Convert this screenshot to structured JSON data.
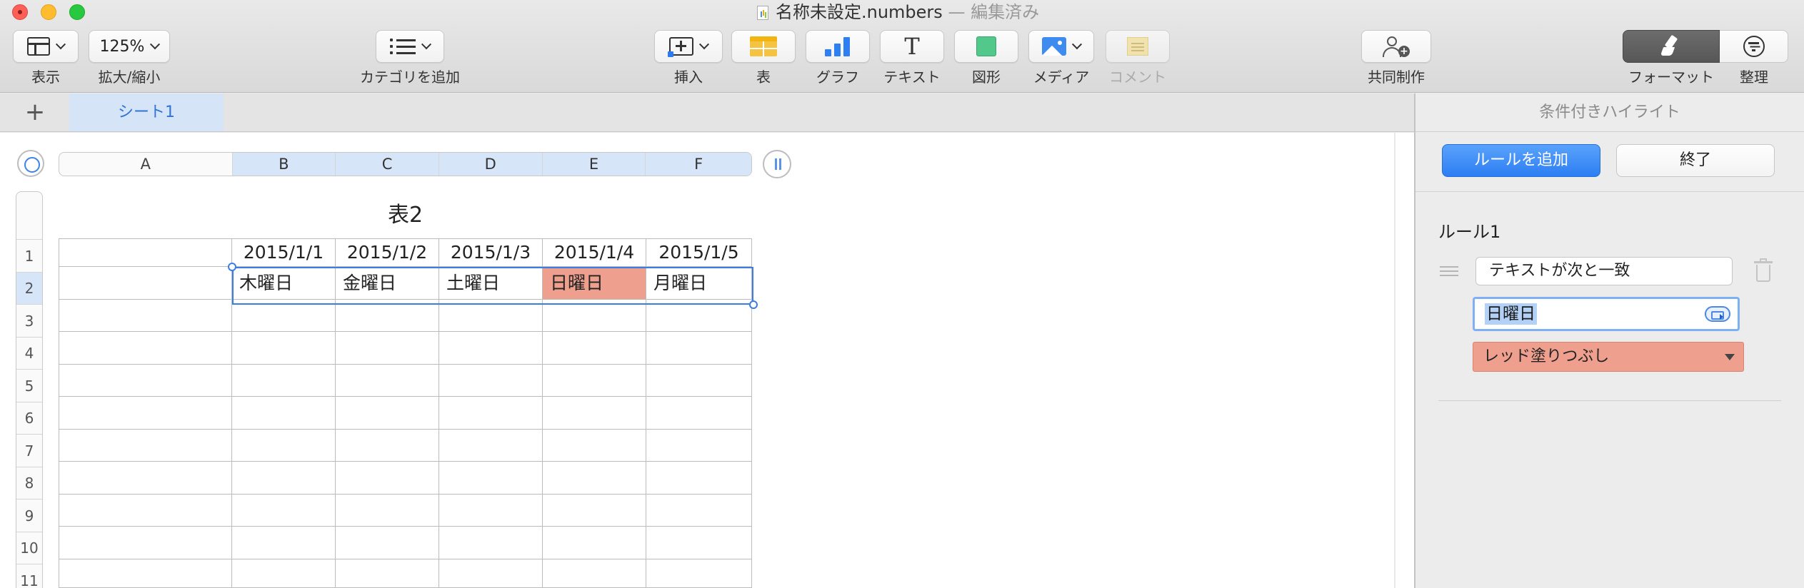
{
  "window": {
    "title": "名称未設定.numbers",
    "edited_suffix": "— 編集済み"
  },
  "toolbar": {
    "view_label": "表示",
    "zoom_value": "125%",
    "zoom_label": "拡大/縮小",
    "category_label": "カテゴリを追加",
    "insert_label": "挿入",
    "table_label": "表",
    "chart_label": "グラフ",
    "text_label": "テキスト",
    "shape_label": "図形",
    "media_label": "メディア",
    "comment_label": "コメント",
    "collaborate_label": "共同制作",
    "format_label": "フォーマット",
    "organize_label": "整理",
    "colors": {
      "chart_blue": "#2e7ff1",
      "table_yellow": "#f5c242",
      "shape_green": "#52c88b",
      "media_blue": "#3f8cf0"
    },
    "icons": [
      "view-icon",
      "list-icon",
      "insert-icon",
      "table-icon",
      "chart-icon",
      "text-icon",
      "shape-icon",
      "media-icon",
      "comment-icon",
      "collaborate-icon",
      "paintbrush-icon",
      "organize-icon"
    ]
  },
  "sheets": {
    "add_symbol": "+",
    "tabs": [
      {
        "label": "シート1",
        "active": true
      }
    ]
  },
  "spreadsheet": {
    "columns": [
      "A",
      "B",
      "C",
      "D",
      "E",
      "F"
    ],
    "selected_columns": [
      "B",
      "C",
      "D",
      "E",
      "F"
    ],
    "rows": [
      "1",
      "2",
      "3",
      "4",
      "5",
      "6",
      "7",
      "8",
      "9",
      "10",
      "11"
    ],
    "selected_row": "2",
    "table_title": "表2",
    "header_row": [
      "",
      "2015/1/1",
      "2015/1/2",
      "2015/1/3",
      "2015/1/4",
      "2015/1/5"
    ],
    "data_row": [
      "",
      "木曜日",
      "金曜日",
      "土曜日",
      "日曜日",
      "月曜日"
    ],
    "highlighted_cell": "E2",
    "highlight_color": "#ee9f8e",
    "selection_color": "#3b7ee3"
  },
  "panel": {
    "title": "条件付きハイライト",
    "add_rule_label": "ルールを追加",
    "done_label": "終了",
    "rule": {
      "name": "ルール1",
      "condition": "テキストが次と一致",
      "value": "日曜日",
      "style": "レッド塗りつぶし",
      "style_color": "#ee9f8e"
    },
    "accent_color": "#2c7ef3"
  }
}
